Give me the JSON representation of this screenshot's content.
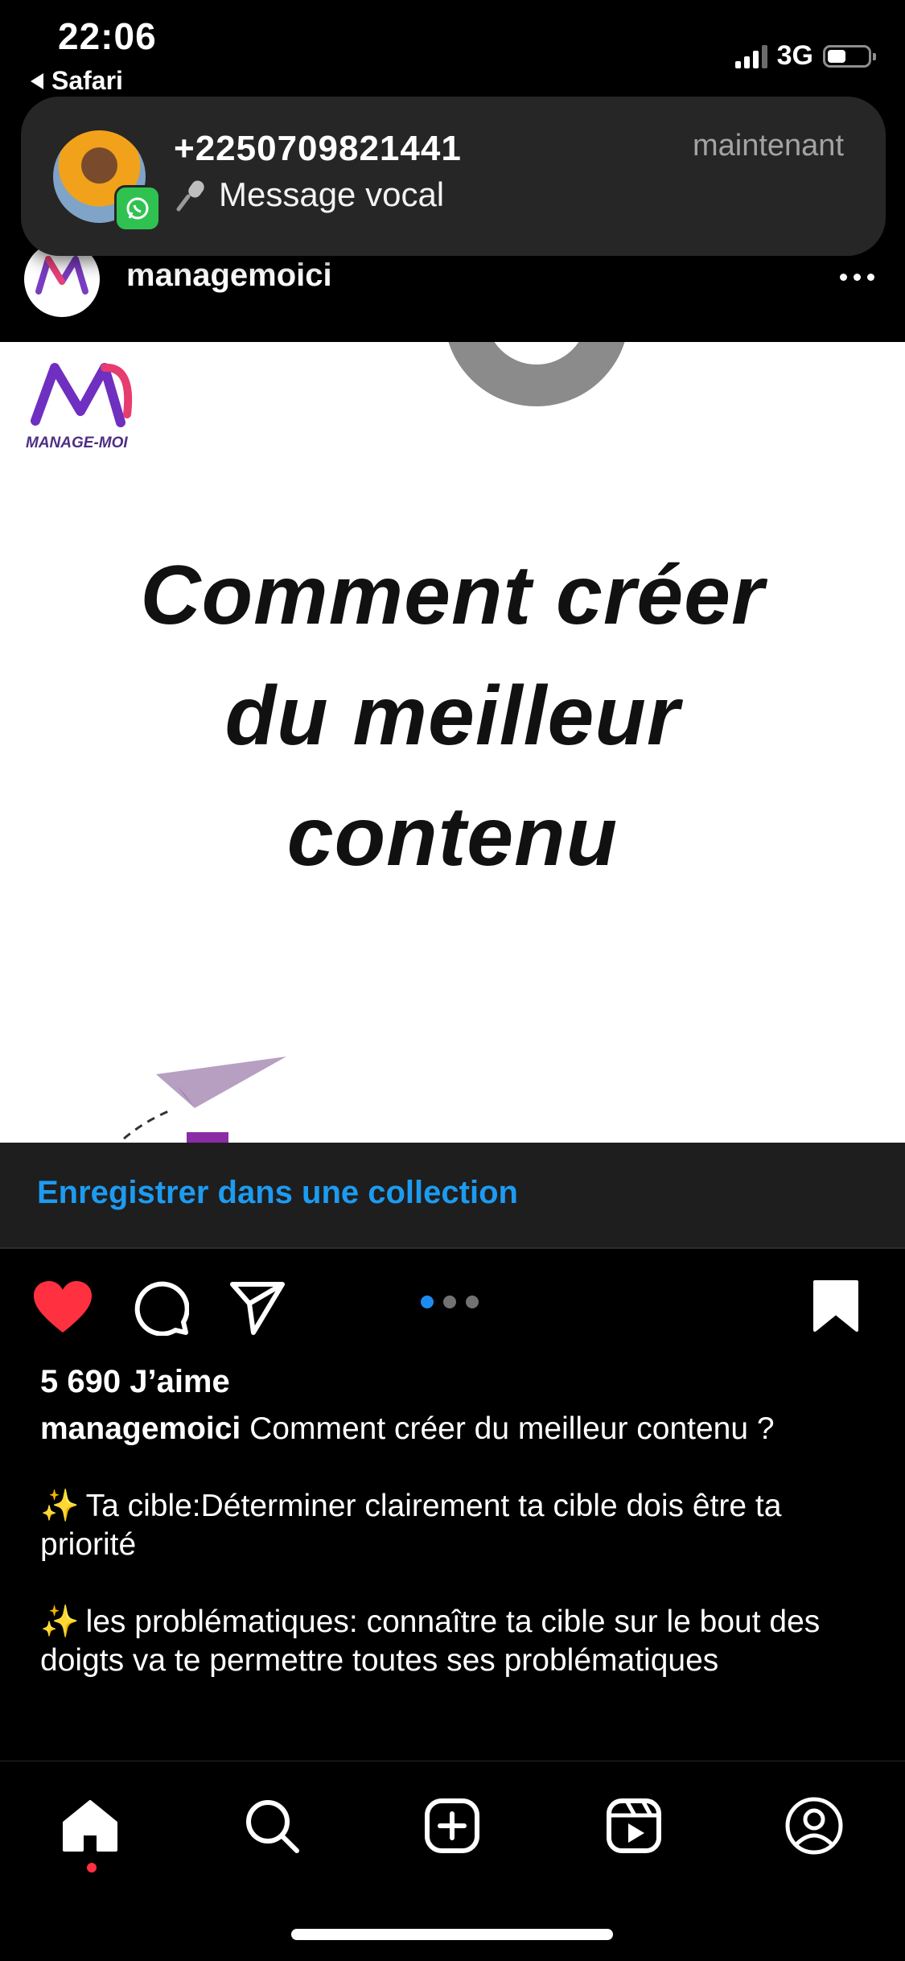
{
  "status": {
    "time": "22:06",
    "back_label": "Safari",
    "network": "3G"
  },
  "notification": {
    "title": "+2250709821441",
    "message": "Message vocal",
    "time": "maintenant",
    "app_icon": "whatsapp-icon",
    "message_icon": "microphone-icon"
  },
  "post": {
    "username": "managemoici",
    "brand_logo_text": "MANAGE-MOI",
    "image_headline_lines": [
      "Comment créer",
      "du meilleur",
      "contenu"
    ],
    "carousel": {
      "count": 3,
      "active_index": 0
    }
  },
  "save_banner": {
    "label": "Enregistrer dans une collection"
  },
  "actions": {
    "liked": true,
    "saved": true
  },
  "likes_text": "5 690 J’aime",
  "caption": {
    "username": "managemoici",
    "first_line": "Comment créer du meilleur contenu ?",
    "points": [
      "Ta cible:Déterminer clairement ta cible dois être ta priorité",
      "les problématiques: connaître ta cible sur le bout des doigts va te permettre toutes ses problématiques"
    ],
    "sparkle": "✨"
  },
  "nav": {
    "items": [
      "home-icon",
      "search-icon",
      "create-icon",
      "reels-icon",
      "profile-icon"
    ]
  },
  "colors": {
    "accent_blue": "#1d9bf0",
    "like_red": "#ff3040",
    "banner_bg": "#262626"
  }
}
